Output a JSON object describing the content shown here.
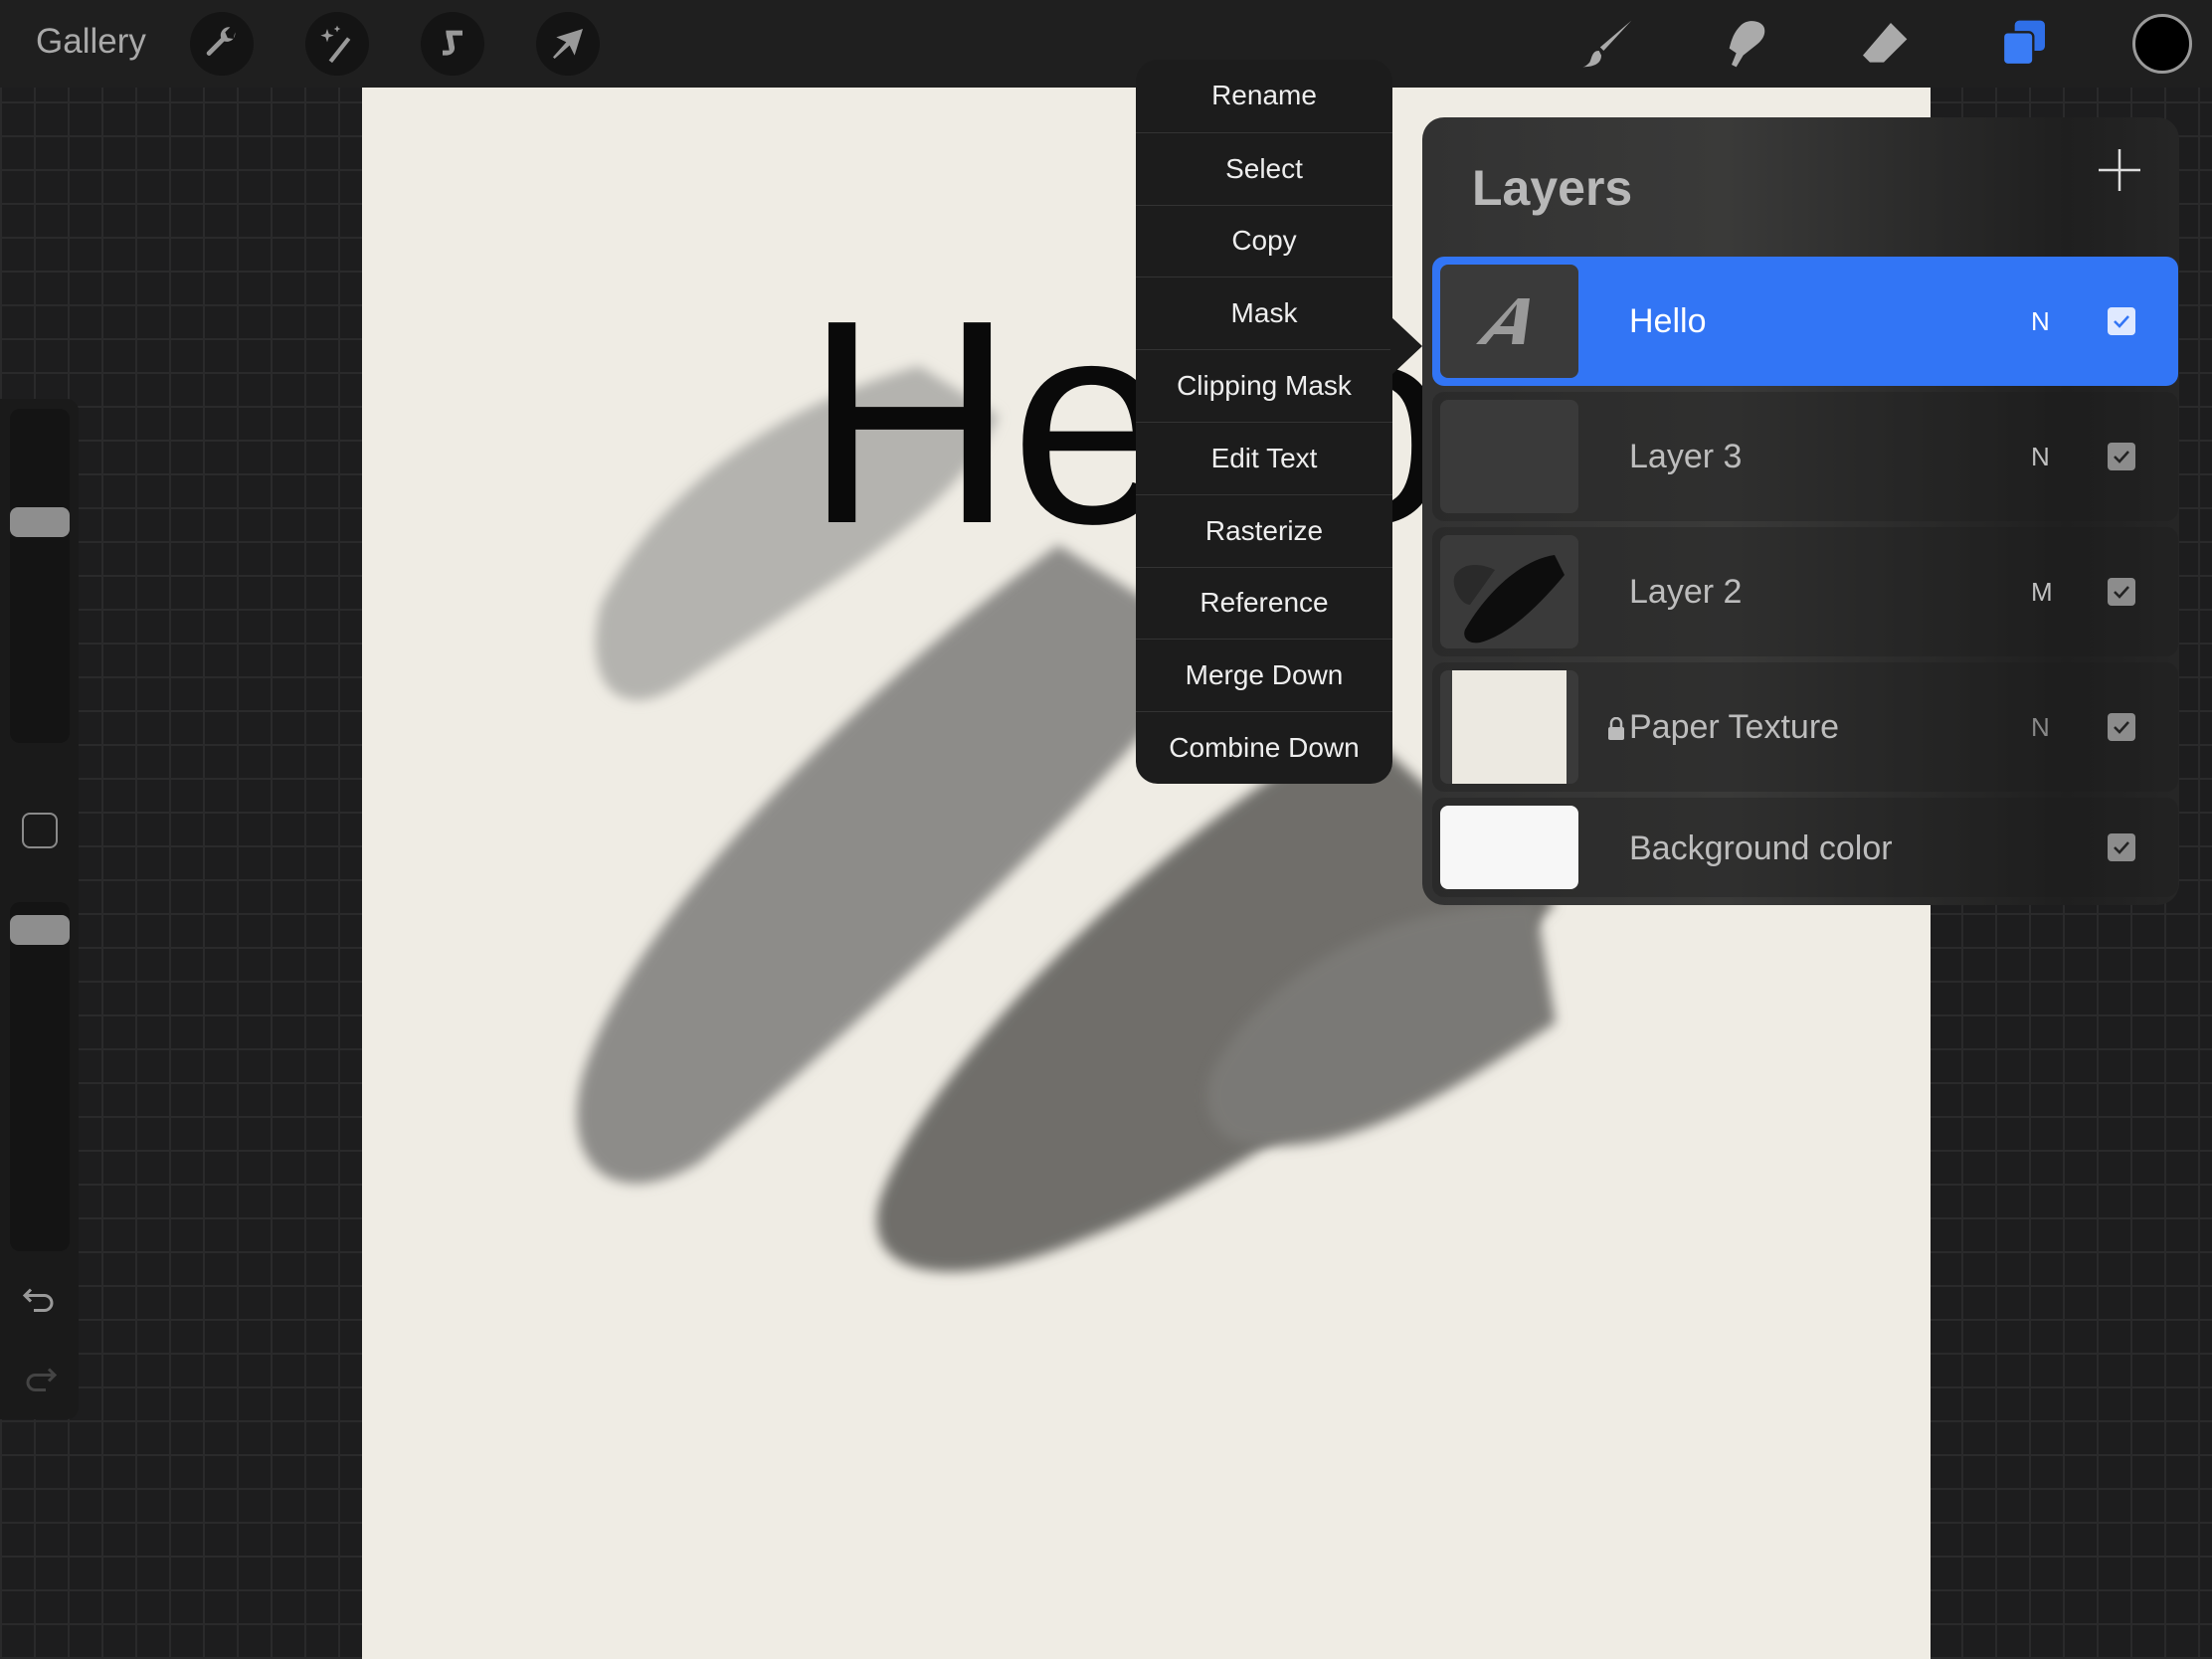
{
  "topbar": {
    "gallery_label": "Gallery",
    "left_tools": [
      "wrench-icon",
      "magic-wand-icon",
      "selection-s-icon",
      "move-arrow-icon"
    ],
    "right_tools": [
      "brush-icon",
      "smudge-icon",
      "eraser-icon",
      "layers-icon",
      "color-swatch"
    ],
    "current_color": "#000000"
  },
  "canvas": {
    "text": "Hello"
  },
  "context_menu": {
    "items": [
      "Rename",
      "Select",
      "Copy",
      "Mask",
      "Clipping Mask",
      "Edit Text",
      "Rasterize",
      "Reference",
      "Merge Down",
      "Combine Down"
    ]
  },
  "layers_panel": {
    "title": "Layers",
    "accent": "#3275f5",
    "layers": [
      {
        "name": "Hello",
        "mode": "N",
        "visible": true,
        "selected": true,
        "thumb": "text-A"
      },
      {
        "name": "Layer 3",
        "mode": "N",
        "visible": true,
        "thumb": "empty"
      },
      {
        "name": "Layer 2",
        "mode": "M",
        "visible": true,
        "thumb": "strokes"
      },
      {
        "name": "Paper Texture",
        "mode": "N",
        "visible": true,
        "locked": true,
        "thumb": "paper"
      },
      {
        "name": "Background color",
        "mode": "",
        "visible": true,
        "thumb": "white"
      }
    ]
  },
  "sidebar": {
    "brush_size": 0.62,
    "opacity": 0.95
  }
}
